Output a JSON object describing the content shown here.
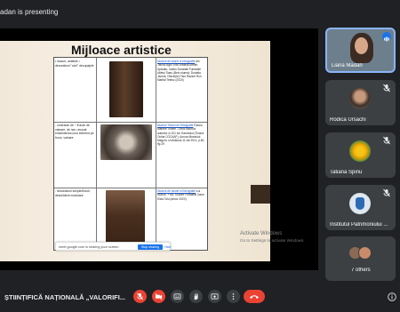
{
  "header": {
    "presenting_pill": "Madan",
    "presenting_text": "adan is presenting"
  },
  "slide": {
    "title": "Mijloace artistice",
    "rows": [
      {
        "left": "• stucuri, avtalkie • decoratiuni \"ochi\" decupajele",
        "right_link": "Muzeul de istorie si etnografie",
        "right": "din Tanctu Agrii 1950 Instituit Altmel; Aparatu; nostru Societati Fundatiei Atletul Sasu (Belo stuma); Donatia Jacent; Obicei(le) Fam Rauzel Ron Marital Tetesc (2020)"
      },
      {
        "left": "- contracte de ~ frunze de valoare, de ras • avocat evidentierea unui element pe frunz, valoare",
        "right_link": "Muzeul Tinutul de Etnografie",
        "right": "Fasciu Matrele Tonele - Orbic Istoricul autorilor si 221 lon Ganetului (Tinarul Ochia COCAAF), Aurora Museului Magurii, si Moldova 11 Iali 2011, p.60, fig 29"
      },
      {
        "left": "- decoratiuni simple/fluturi, deschidere modulare",
        "right_link": "Muzeul de Istorie si Etnografie",
        "right": "s-a Morlok, + sul, Sodore Fundatiei Dane Eliza Tolu (decor 2020)"
      }
    ],
    "share_bar": {
      "text": "meet.google.com is sharing your screen.",
      "stop_label": "Stop sharing",
      "hide_label": "Hide"
    }
  },
  "watermark": {
    "line1": "Activate Windows",
    "line2": "Go to Settings to activate Windows."
  },
  "participants": [
    {
      "name": "Liana Madan",
      "active": true
    },
    {
      "name": "Rodica Ursachi",
      "active": false
    },
    {
      "name": "Tatiana Spinu",
      "active": false
    },
    {
      "name": "Institutul Patrimoniului ...",
      "active": false
    }
  ],
  "others": {
    "label": "7 others"
  },
  "meeting": {
    "title": "ȘTIINȚIFICĂ NAȚIONALĂ „VALORIFI..."
  },
  "colors": {
    "background": "#202124",
    "tile": "#3c4043",
    "danger": "#ea4335",
    "accent": "#1a73e8"
  }
}
